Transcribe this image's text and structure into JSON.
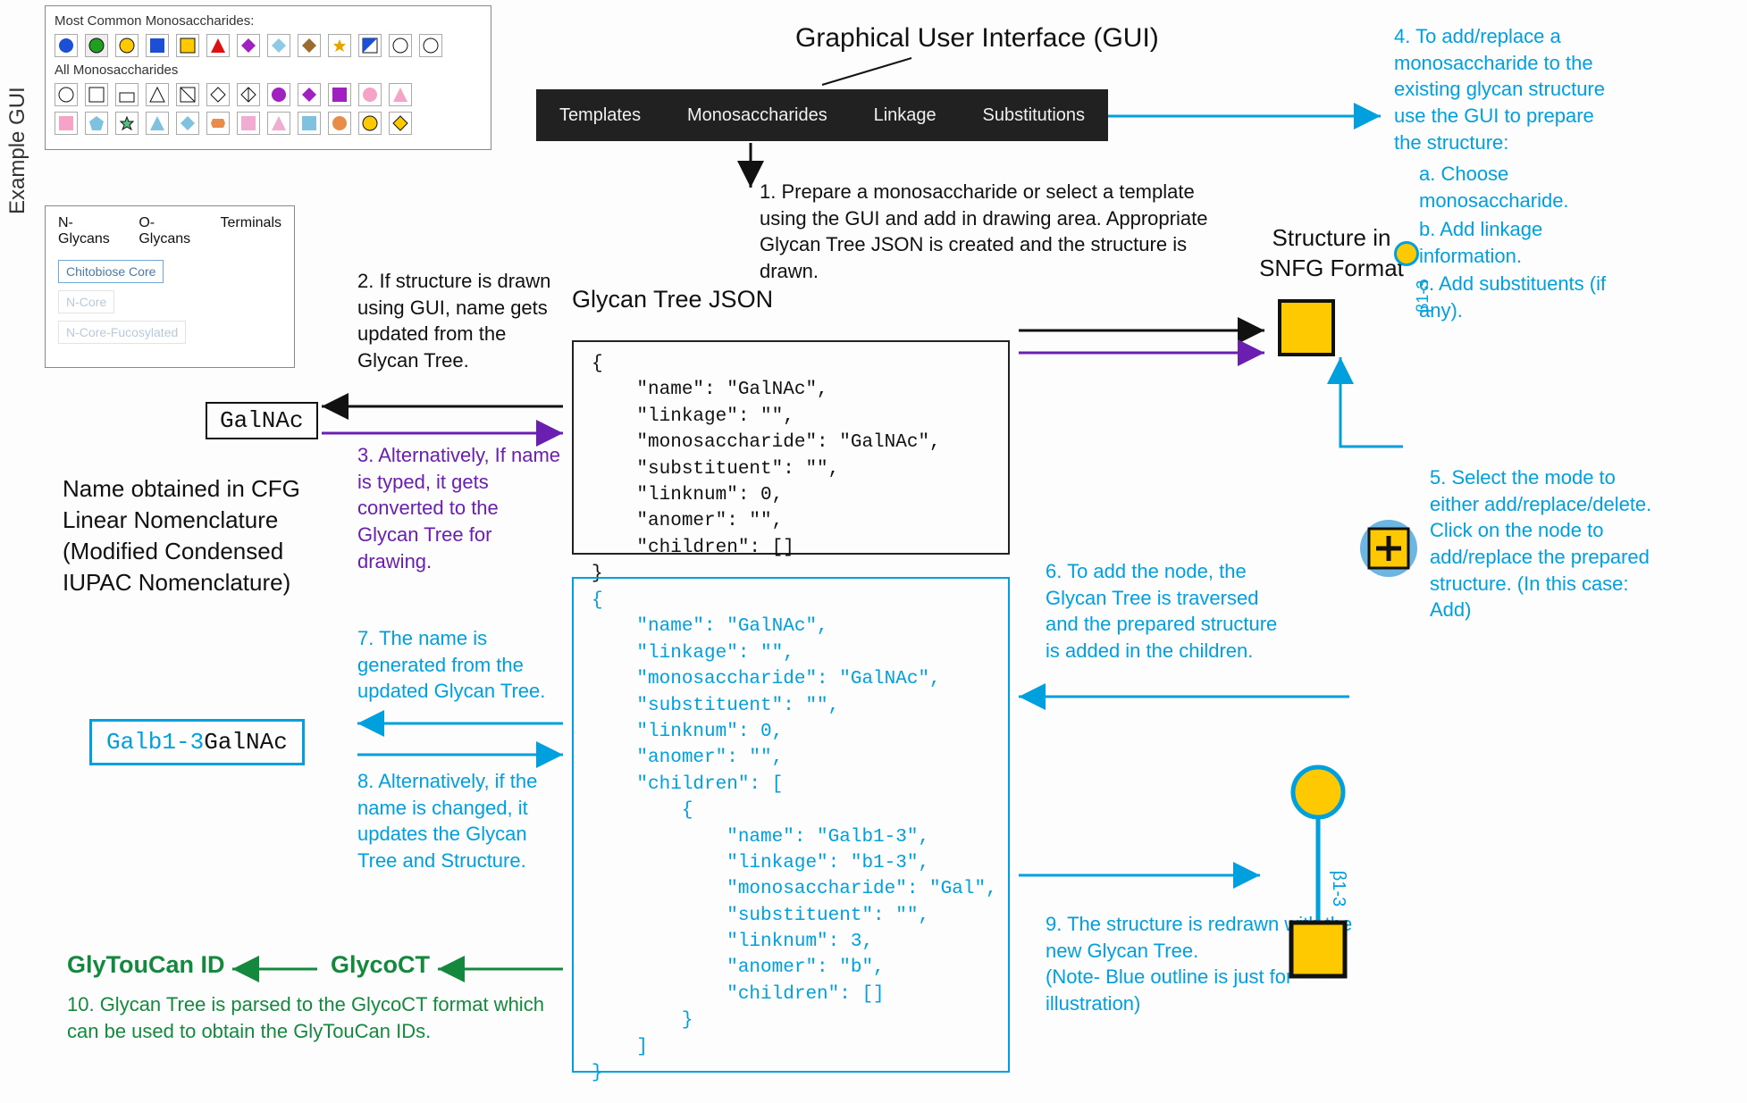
{
  "example_gui_label": "Example GUI",
  "panel1": {
    "heading1": "Most Common Monosaccharides:",
    "heading2": "All Monosaccharides"
  },
  "panel2": {
    "tabs": [
      "N-Glycans",
      "O-Glycans",
      "Terminals"
    ],
    "chips": [
      "Chitobiose Core",
      "N-Core",
      "N-Core-Fucosylated"
    ]
  },
  "menubar": [
    "Templates",
    "Monosaccharides",
    "Linkage",
    "Substitutions"
  ],
  "gui_title": "Graphical User Interface (GUI)",
  "step1": "1. Prepare a monosaccharide or select a template using the GUI and add in drawing area. Appropriate Glycan Tree JSON is created and the structure is drawn.",
  "step2": "2. If structure is drawn using GUI, name gets updated from the Glycan Tree.",
  "step3": "3. Alternatively, If name is typed, it gets converted to the Glycan Tree for drawing.",
  "glycan_json_heading": "Glycan Tree JSON",
  "json1": "{\n    \"name\": \"GalNAc\",\n    \"linkage\": \"\",\n    \"monosaccharide\": \"GalNAc\",\n    \"substituent\": \"\",\n    \"linknum\": 0,\n    \"anomer\": \"\",\n    \"children\": []\n}",
  "snfg_label": "Structure in SNFG Format",
  "name_cfg": "Name obtained in CFG Linear Nomenclature (Modified Condensed IUPAC Nomenclature)",
  "galnac": "GalNAc",
  "step4": {
    "intro": "4. To add/replace a monosaccharide to the existing glycan structure use the GUI to prepare the structure:",
    "a": "a. Choose monosaccharide.",
    "b": "b. Add linkage information.",
    "c": "c. Add substituents (if any).",
    "rotlabel": "β1-3"
  },
  "step5": "5. Select the mode to either add/replace/delete. Click on the node to add/replace the prepared structure. (In this case: Add)",
  "step6": "6. To add the node, the Glycan Tree is traversed and the prepared structure is added in the children.",
  "json2": "{\n    \"name\": \"GalNAc\",\n    \"linkage\": \"\",\n    \"monosaccharide\": \"GalNAc\",\n    \"substituent\": \"\",\n    \"linknum\": 0,\n    \"anomer\": \"\",\n    \"children\": [\n        {\n            \"name\": \"Galb1-3\",\n            \"linkage\": \"b1-3\",\n            \"monosaccharide\": \"Gal\",\n            \"substituent\": \"\",\n            \"linknum\": 3,\n            \"anomer\": \"b\",\n            \"children\": []\n        }\n    ]\n}",
  "step7": "7. The name is generated from the updated Glycan Tree.",
  "step8": "8. Alternatively, if the name is changed, it updates the Glycan Tree and Structure.",
  "galb_blue": "Galb1-3",
  "galb_black": "GalNAc",
  "step9": "9. The structure is redrawn with the new Glycan Tree.\n(Note- Blue outline is just for illustration)",
  "snfg2_rotlabel": "β1-3",
  "glycoct": "GlycoCT",
  "glytoucan": "GlyTouCan ID",
  "step10": "10. Glycan Tree is parsed to the GlycoCT format which can be used to obtain the GlyTouCan IDs."
}
